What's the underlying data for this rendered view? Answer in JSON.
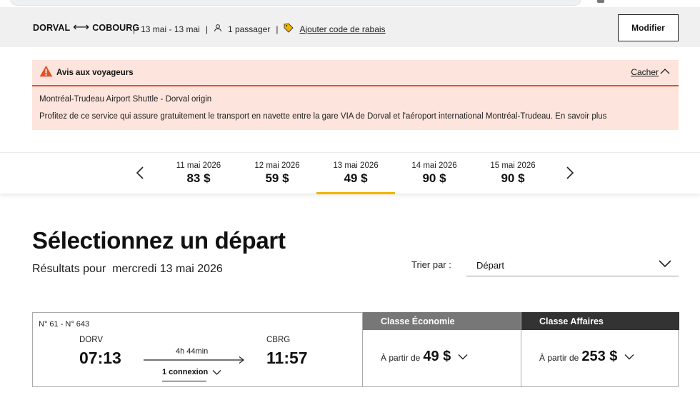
{
  "search_summary": {
    "origin": "DORVAL",
    "destination": "COBOURG",
    "dates": "13 mai - 13 mai",
    "passengers": "1 passager",
    "discount_link": "Ajouter code de rabais",
    "modify_label": "Modifier"
  },
  "notice": {
    "title": "Avis aux voyageurs",
    "hide_label": "Cacher",
    "line1": "Montréal-Trudeau Airport Shuttle - Dorval origin",
    "line2": "Profitez de ce service qui assure gratuitement le transport en navette entre la gare VIA de Dorval et l'aéroport international Montréal-Trudeau. En savoir plus"
  },
  "date_carousel": {
    "days": [
      {
        "date": "11 mai 2026",
        "price": "83 $"
      },
      {
        "date": "12 mai 2026",
        "price": "59 $"
      },
      {
        "date": "13 mai 2026",
        "price": "49 $",
        "selected": true
      },
      {
        "date": "14 mai 2026",
        "price": "90 $"
      },
      {
        "date": "15 mai 2026",
        "price": "90 $"
      }
    ]
  },
  "main": {
    "heading": "Sélectionnez un départ",
    "results_prefix": "Résultats pour",
    "results_date": "mercredi 13 mai 2026",
    "sort_label": "Trier par :",
    "sort_value": "Départ"
  },
  "trip": {
    "train_numbers": "N° 61 - N° 643",
    "from_code": "DORV",
    "depart_time": "07:13",
    "duration": "4h 44min",
    "connections": "1 connexion",
    "to_code": "CBRG",
    "arrive_time": "11:57",
    "fares": {
      "economy": {
        "label": "Classe Économie",
        "from": "À partir de",
        "price": "49 $"
      },
      "business": {
        "label": "Classe Affaires",
        "from": "À partir de",
        "price": "253 $"
      }
    }
  },
  "colors": {
    "notice_bg": "#fde4dd",
    "notice_accent": "#e0522a",
    "selected_date_bar": "#f2b300",
    "economy_header": "#777777",
    "business_header": "#333333",
    "discount_tag": "#f2b300"
  },
  "icons": [
    "warning-icon",
    "chevron-up-icon",
    "chevron-left-icon",
    "chevron-right-icon",
    "chevron-down-icon",
    "user-icon",
    "tag-icon",
    "double-arrow-icon",
    "arrow-right-icon"
  ]
}
